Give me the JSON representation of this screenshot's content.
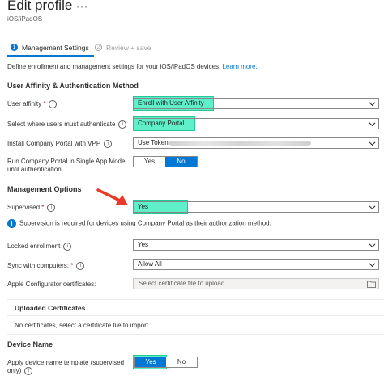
{
  "header": {
    "title": "Edit profile",
    "more": "···",
    "subtitle": "iOS/iPadOS"
  },
  "steps": [
    {
      "number": "1",
      "label": "Management Settings"
    },
    {
      "number": "2",
      "label": "Review + save"
    }
  ],
  "intro": {
    "text": "Define enrollment and management settings for your iOS/iPadOS devices.",
    "link": "Learn more."
  },
  "sections": {
    "affinity": "User Affinity & Authentication Method",
    "management": "Management Options",
    "uploaded": "Uploaded Certificates",
    "device_name": "Device Name"
  },
  "fields": {
    "user_affinity": {
      "label": "User affinity",
      "value": "Enroll with User Affinity"
    },
    "auth_where": {
      "label": "Select where users must authenticate",
      "value": "Company Portal"
    },
    "vpp": {
      "label": "Install Company Portal with VPP",
      "value": "Use Token:"
    },
    "single_app": {
      "label": "Run Company Portal in Single App Mode until authentication",
      "yes": "Yes",
      "no": "No",
      "selected": "No"
    },
    "supervised": {
      "label": "Supervised",
      "value": "Yes"
    },
    "locked": {
      "label": "Locked enrollment",
      "value": "Yes"
    },
    "sync": {
      "label": "Sync with computers:",
      "value": "Allow All"
    },
    "configurator": {
      "label": "Apple Configurator certificates:",
      "placeholder": "Select certificate file to upload"
    },
    "device_template": {
      "label": "Apply device name template (supervised only)",
      "yes": "Yes",
      "no": "No",
      "selected": "Yes"
    }
  },
  "supervision_info": "Supervision is required for devices using Company Portal as their authorization method.",
  "no_certs": "No certificates, select a certificate file to import.",
  "colors": {
    "accent": "#0078d4",
    "highlight": "#5ff0c9",
    "required": "#a4262c",
    "arrow": "#e8392b"
  }
}
